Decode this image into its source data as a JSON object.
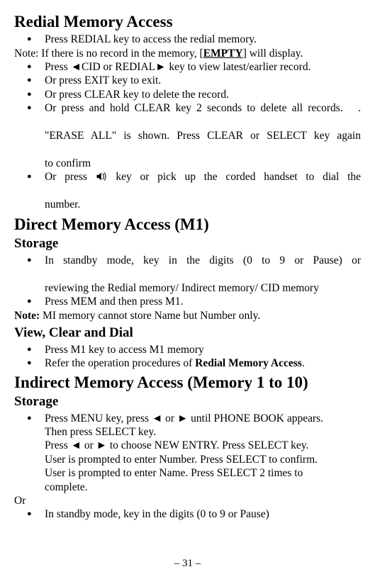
{
  "section1": {
    "title": "Redial Memory Access",
    "items": [
      "Press REDIAL key to access the redial memory."
    ],
    "note_line": [
      "Note: If there is no record in the memory, [",
      "EMPTY",
      "] will display."
    ],
    "items2": [
      "Press ◄CID or REDIAL► key to view latest/earlier record.",
      "Or press EXIT key to exit.",
      "Or press CLEAR key to delete the record."
    ],
    "item_long": {
      "line1": "Or press and hold CLEAR key 2 seconds to delete all records.",
      "line1_end": ".",
      "line2": "\"ERASE ALL\" is shown. Press CLEAR or SELECT key again",
      "line3": "to confirm"
    },
    "item_speaker": {
      "pre": "Or press",
      "post": "key or pick up the corded handset to dial the",
      "line2": "number."
    }
  },
  "section2": {
    "title": "Direct Memory Access (M1)",
    "sub1": "Storage",
    "storage_items": [
      {
        "lines": [
          "In standby mode, key in the digits (0 to 9 or Pause) or",
          "reviewing the Redial memory/ Indirect memory/ CID memory"
        ]
      },
      {
        "lines": [
          "Press MEM and then press M1."
        ]
      }
    ],
    "note_bold": "Note:",
    "note_rest": " MI memory cannot store Name but Number only.",
    "sub2": "View, Clear and Dial",
    "view_items": [
      "Press M1 key to access M1 memory"
    ],
    "view_item2_pre": "Refer the operation procedures of ",
    "view_item2_bold": "Redial Memory Access",
    "view_item2_post": "."
  },
  "section3": {
    "title": "Indirect Memory Access (Memory 1 to 10)",
    "sub1": "Storage",
    "item1": "Press MENU key, press ◄ or ► until PHONE BOOK appears.",
    "cont": [
      "Then press SELECT key.",
      "Press ◄ or ► to choose NEW ENTRY. Press SELECT key.",
      "User is prompted to enter Number. Press SELECT to confirm.",
      "User is prompted to enter Name. Press SELECT 2 times to",
      "complete."
    ],
    "or": "Or",
    "item2": "In standby mode, key in the digits (0 to 9 or Pause)"
  },
  "page_number": "– 31 –"
}
